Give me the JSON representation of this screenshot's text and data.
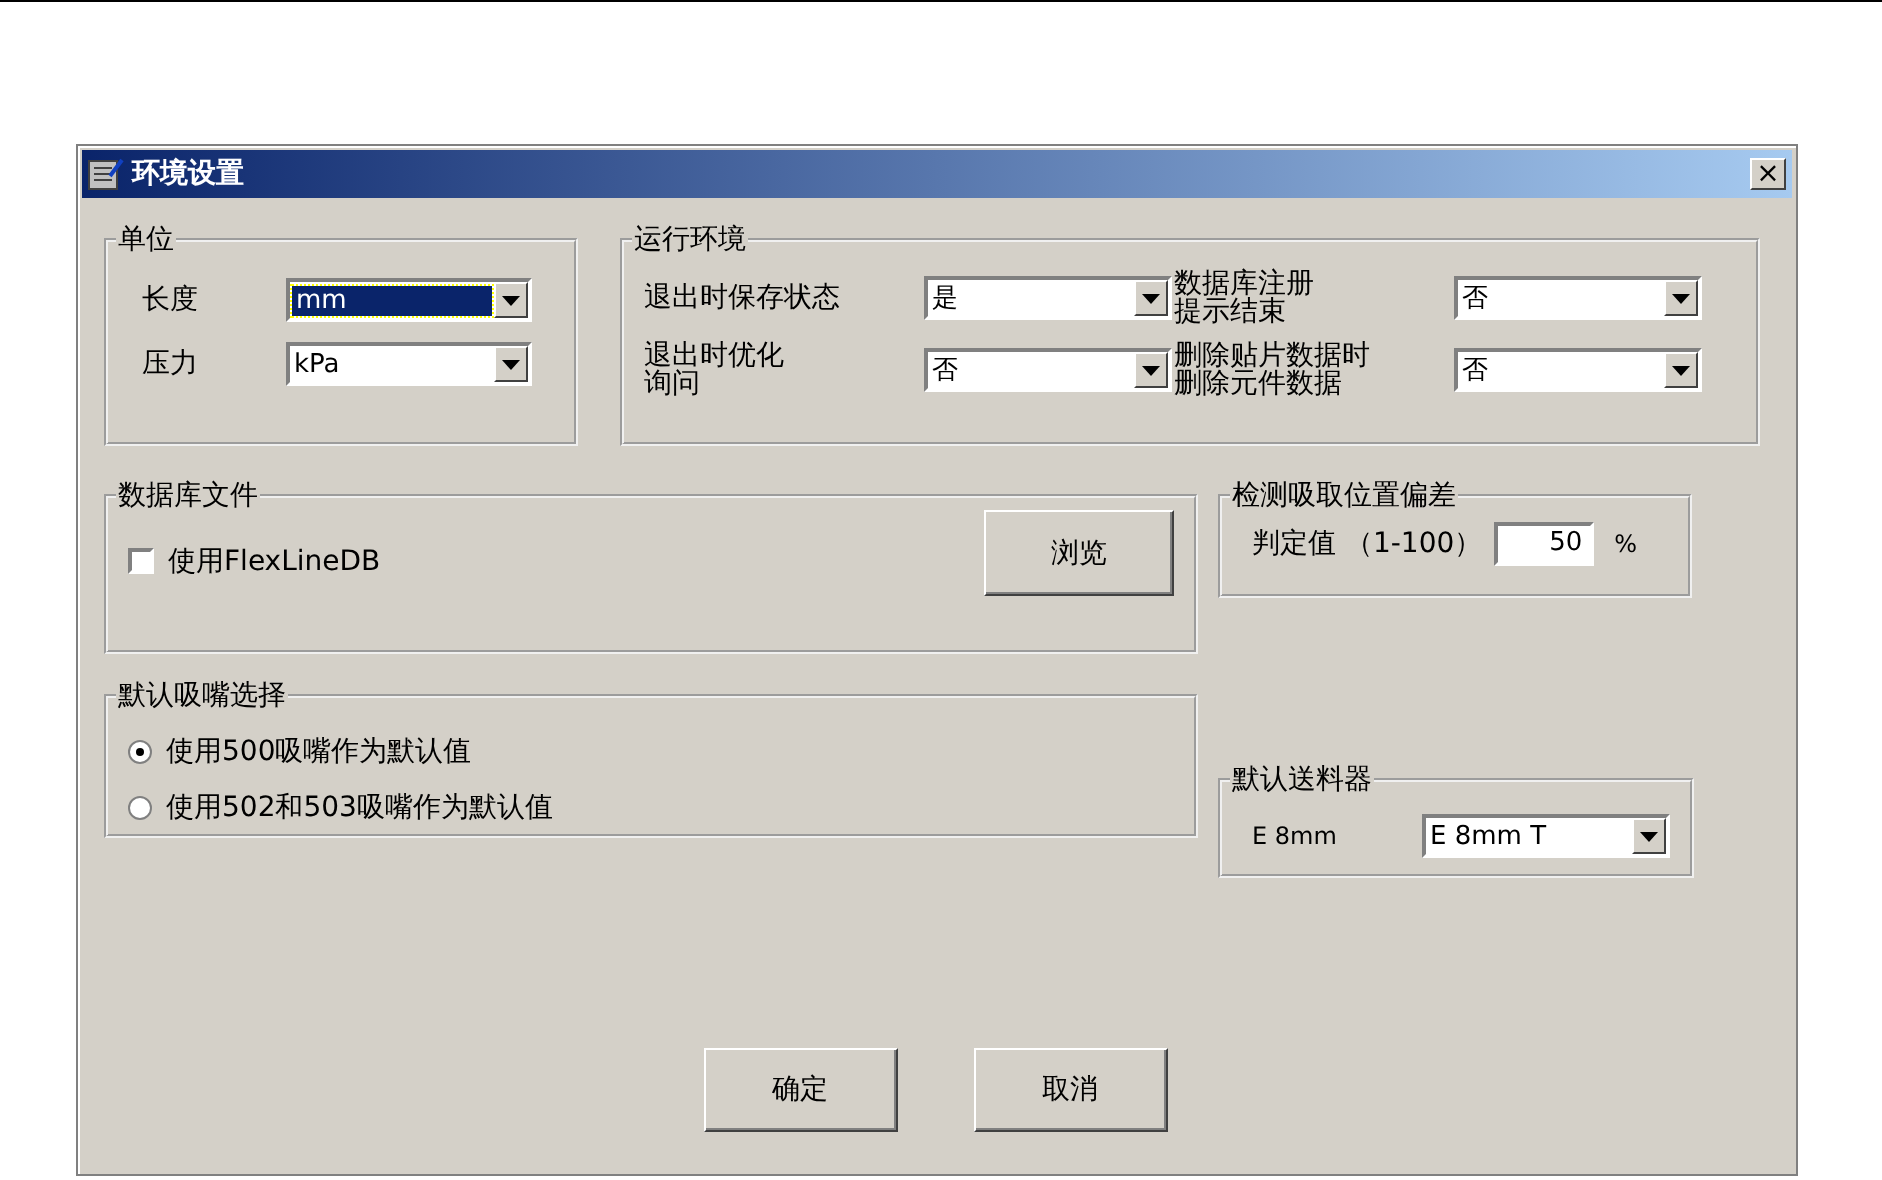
{
  "window": {
    "title": "环境设置",
    "close": "×"
  },
  "units": {
    "title": "单位",
    "fields": [
      {
        "label": "长度",
        "value": "mm",
        "focused": true
      },
      {
        "label": "压力",
        "value": "kPa",
        "focused": false
      }
    ]
  },
  "runtime": {
    "title": "运行环境",
    "fields": [
      {
        "label_lines": [
          "退出时保存状态"
        ],
        "value": "是"
      },
      {
        "label_lines": [
          "数据库注册",
          "提示结束"
        ],
        "value": "否"
      },
      {
        "label_lines": [
          "退出时优化",
          "询问"
        ],
        "value": "否"
      },
      {
        "label_lines": [
          "删除贴片数据时",
          "删除元件数据"
        ],
        "value": "否"
      }
    ]
  },
  "database": {
    "title": "数据库文件",
    "checkbox": {
      "label": "使用FlexLineDB",
      "checked": false
    },
    "browse": "浏览"
  },
  "nozzle": {
    "title": "默认吸嘴选择",
    "options": [
      {
        "label": "使用500吸嘴作为默认值",
        "selected": true
      },
      {
        "label": "使用502和503吸嘴作为默认值",
        "selected": false
      }
    ]
  },
  "offset": {
    "title": "检测吸取位置偏差",
    "label": "判定值 （1-100）",
    "value": "50",
    "unit": "%"
  },
  "feeder": {
    "title": "默认送料器",
    "label": "E 8mm",
    "value": "E 8mm T"
  },
  "buttons": [
    "确定",
    "取消"
  ]
}
